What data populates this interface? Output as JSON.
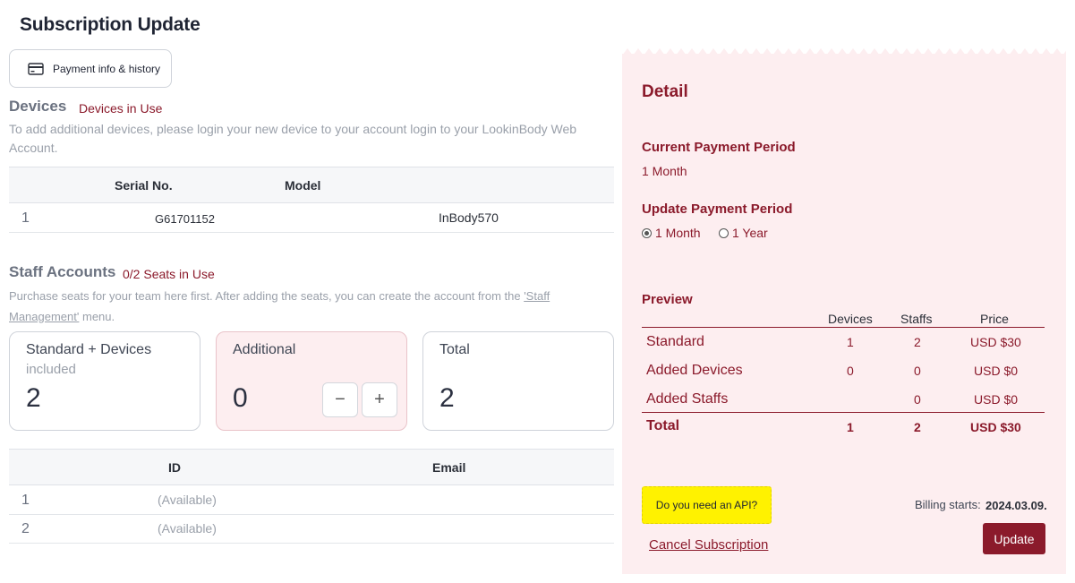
{
  "page": {
    "title": "Subscription Update"
  },
  "toolbar": {
    "payment_label": "Payment info & history"
  },
  "devices": {
    "title": "Devices",
    "badge": "Devices in Use",
    "description": "To add additional devices, please login your new device to your account login to your LookinBody Web Account.",
    "columns": [
      "Serial No.",
      "Model"
    ],
    "rows": [
      {
        "num": "1",
        "serial": "G61701152",
        "model": "InBody570"
      }
    ]
  },
  "staff": {
    "title": "Staff Accounts",
    "badge": "0/2 Seats in Use",
    "description_pre": "Purchase seats for your team here first. After adding the seats, you can create the account from the ",
    "description_link": "'Staff Management'",
    "description_post": " menu.",
    "cards": {
      "standard": {
        "title": "Standard + Devices",
        "sub": "included",
        "value": "2"
      },
      "additional": {
        "title": "Additional",
        "value": "0",
        "minus": "−",
        "plus": "+"
      },
      "total": {
        "title": "Total",
        "value": "2"
      }
    },
    "columns": [
      "ID",
      "Email"
    ],
    "rows": [
      {
        "num": "1",
        "id": "(Available)"
      },
      {
        "num": "2",
        "id": "(Available)"
      }
    ]
  },
  "detail": {
    "title": "Detail",
    "current_label": "Current Payment Period",
    "current_value": "1 Month",
    "update_label": "Update Payment Period",
    "options": [
      {
        "label": "1 Month",
        "selected": true
      },
      {
        "label": "1 Year",
        "selected": false
      }
    ],
    "preview": {
      "title": "Preview",
      "columns": [
        "Devices",
        "Staffs",
        "Price"
      ],
      "rows": [
        {
          "label": "Standard",
          "devices": "1",
          "staffs": "2",
          "price": "USD $30"
        },
        {
          "label": "Added Devices",
          "devices": "0",
          "staffs": "0",
          "price": "USD $0"
        },
        {
          "label": "Added Staffs",
          "devices": "",
          "staffs": "0",
          "price": "USD $0"
        }
      ],
      "total": {
        "label": "Total",
        "devices": "1",
        "staffs": "2",
        "price": "USD $30"
      }
    },
    "api_label": "Do you need an API?",
    "cancel_label": "Cancel Subscription",
    "billing_label": "Billing starts:",
    "billing_value": "2024.03.09.",
    "update_label_btn": "Update"
  },
  "colors": {
    "accent": "#8b1a2b",
    "panel_bg": "#fdeef0",
    "highlight": "#fff200"
  }
}
